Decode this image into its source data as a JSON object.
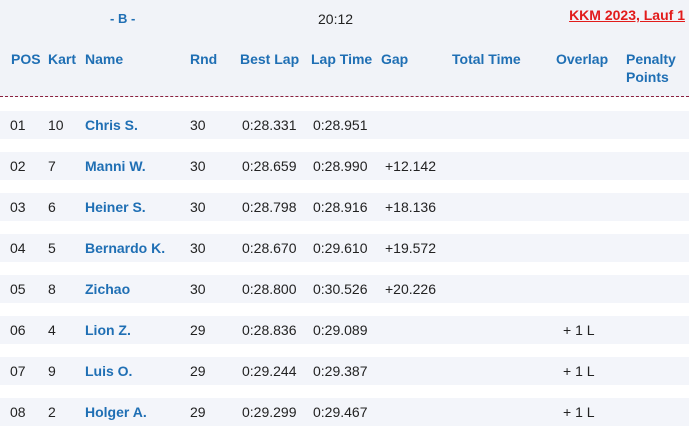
{
  "topbar": {
    "heat": "- B -",
    "clock": "20:12",
    "event": "KKM 2023, Lauf 1"
  },
  "columns": {
    "pos": "POS",
    "kart": "Kart",
    "name": "Name",
    "rnd": "Rnd",
    "best_lap": "Best Lap",
    "lap_time": "Lap Time",
    "gap": "Gap",
    "total_time": "Total Time",
    "overlap": "Overlap",
    "penalty_1": "Penalty",
    "penalty_2": "Points"
  },
  "results": [
    {
      "pos": "01",
      "kart": "10",
      "name": "Chris S.",
      "rnd": "30",
      "best_lap": "0:28.331",
      "lap_time": "0:28.951",
      "gap": "",
      "overlap": ""
    },
    {
      "pos": "02",
      "kart": "7",
      "name": "Manni W.",
      "rnd": "30",
      "best_lap": "0:28.659",
      "lap_time": "0:28.990",
      "gap": "+12.142",
      "overlap": ""
    },
    {
      "pos": "03",
      "kart": "6",
      "name": "Heiner S.",
      "rnd": "30",
      "best_lap": "0:28.798",
      "lap_time": "0:28.916",
      "gap": "+18.136",
      "overlap": ""
    },
    {
      "pos": "04",
      "kart": "5",
      "name": "Bernardo K.",
      "rnd": "30",
      "best_lap": "0:28.670",
      "lap_time": "0:29.610",
      "gap": "+19.572",
      "overlap": ""
    },
    {
      "pos": "05",
      "kart": "8",
      "name": "Zichao",
      "rnd": "30",
      "best_lap": "0:28.800",
      "lap_time": "0:30.526",
      "gap": "+20.226",
      "overlap": ""
    },
    {
      "pos": "06",
      "kart": "4",
      "name": "Lion Z.",
      "rnd": "29",
      "best_lap": "0:28.836",
      "lap_time": "0:29.089",
      "gap": "",
      "overlap": "+ 1 L"
    },
    {
      "pos": "07",
      "kart": "9",
      "name": "Luis O.",
      "rnd": "29",
      "best_lap": "0:29.244",
      "lap_time": "0:29.387",
      "gap": "",
      "overlap": "+ 1 L"
    },
    {
      "pos": "08",
      "kart": "2",
      "name": "Holger A.",
      "rnd": "29",
      "best_lap": "0:29.299",
      "lap_time": "0:29.467",
      "gap": "",
      "overlap": "+ 1 L"
    }
  ]
}
